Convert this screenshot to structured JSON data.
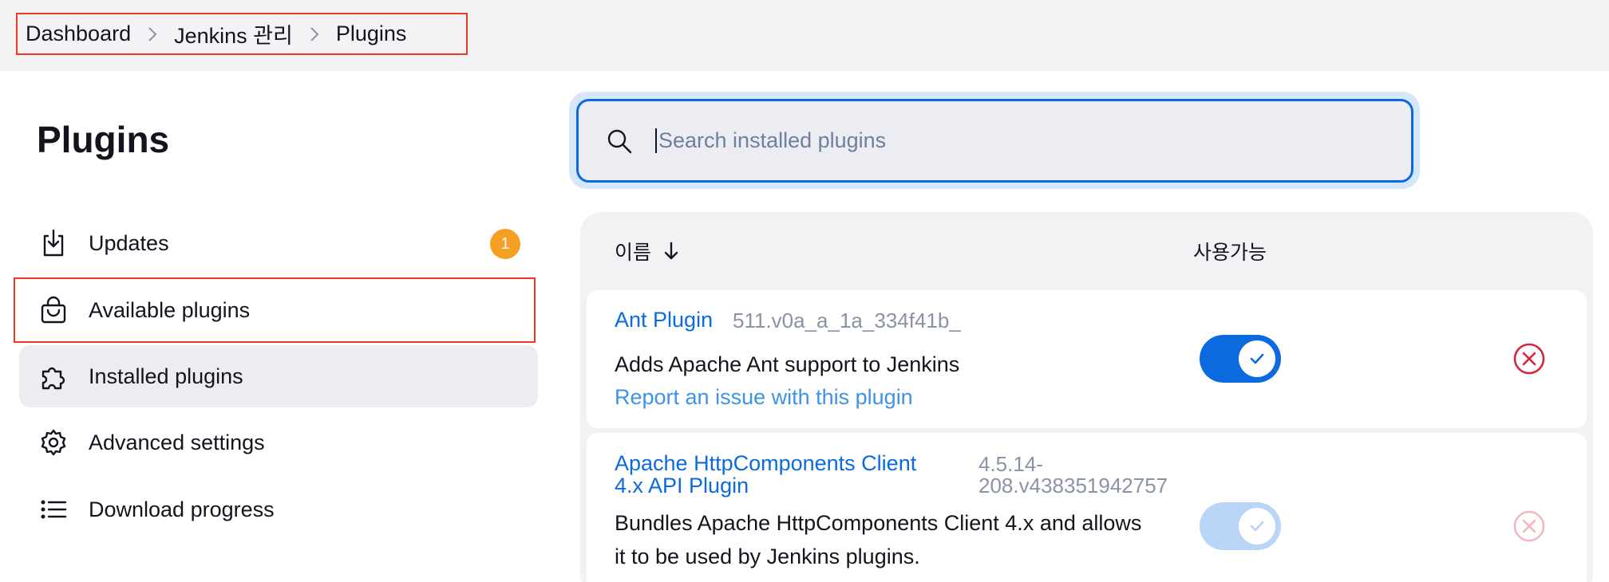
{
  "breadcrumb": {
    "items": [
      "Dashboard",
      "Jenkins 관리",
      "Plugins"
    ]
  },
  "page": {
    "title": "Plugins"
  },
  "sidebar": {
    "items": [
      {
        "label": "Updates",
        "icon": "download-icon",
        "badge": "1"
      },
      {
        "label": "Available plugins",
        "icon": "shopping-bag-icon"
      },
      {
        "label": "Installed plugins",
        "icon": "puzzle-piece-icon",
        "active": true
      },
      {
        "label": "Advanced settings",
        "icon": "gear-icon"
      },
      {
        "label": "Download progress",
        "icon": "list-icon"
      }
    ]
  },
  "search": {
    "placeholder": "Search installed plugins",
    "value": ""
  },
  "table": {
    "headers": {
      "name": "이름",
      "enabled": "사용가능"
    },
    "rows": [
      {
        "name": "Ant Plugin",
        "version": "511.v0a_a_1a_334f41b_",
        "description": "Adds Apache Ant support to Jenkins",
        "link": "Report an issue with this plugin",
        "enabled": true,
        "toggle_disabled": false
      },
      {
        "name_line1": "Apache HttpComponents Client",
        "name_line2": "4.x API Plugin",
        "version_line1": "4.5.14-",
        "version_line2": "208.v438351942757",
        "description_line1": "Bundles Apache HttpComponents Client 4.x and allows",
        "description_line2": "it to be used by Jenkins plugins.",
        "enabled": true,
        "toggle_disabled": true
      }
    ]
  },
  "colors": {
    "accent": "#0b6bde",
    "badge": "#f5a025",
    "danger": "#d6263a",
    "highlight": "#ee3a24"
  }
}
